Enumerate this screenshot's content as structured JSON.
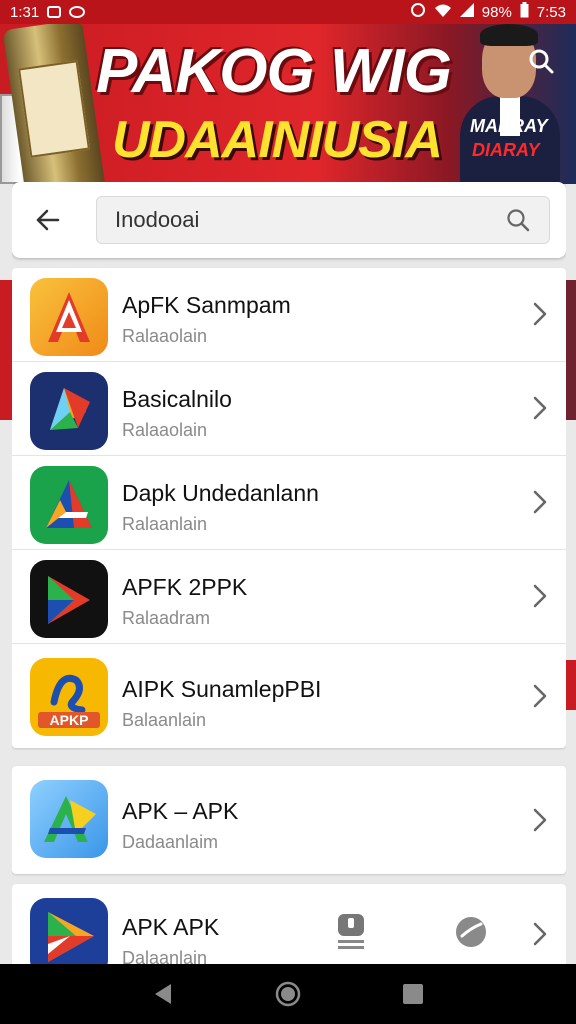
{
  "status_bar": {
    "time_left": "1:31",
    "battery": "98%",
    "time_right": "7:53"
  },
  "banner": {
    "headline_line1": "PAKOG WIG",
    "headline_line2": "UDAAINIUSIA",
    "tag_line1": "MANRAY",
    "tag_line2": "DIARAY"
  },
  "search": {
    "value": "Inodooai"
  },
  "apps": [
    {
      "name": "ApFK Sanmpam",
      "subtitle": "Ralaaolain",
      "icon": "apk-a-orange-icon",
      "color": "#f5a623"
    },
    {
      "name": "Basicalnilo",
      "subtitle": "Ralaaolain",
      "icon": "apk-play-navy-icon",
      "color": "#1c2f6e"
    },
    {
      "name": "Dapk Undedanlann",
      "subtitle": "Ralaanlain",
      "icon": "apk-a-green-icon",
      "color": "#1aa34a"
    },
    {
      "name": "APFK 2PPK",
      "subtitle": "Ralaadram",
      "icon": "apk-play-black-icon",
      "color": "#111111"
    },
    {
      "name": "AIPK SunamlepPBI",
      "subtitle": "Balaanlain",
      "icon": "apk-yellow-icon",
      "color": "#f6b800"
    },
    {
      "name": "APK – APK",
      "subtitle": "Dadaanlaim",
      "icon": "apk-a-sky-icon",
      "color": "#5db3f0"
    },
    {
      "name": "APK APK",
      "subtitle": "Dalaanlain",
      "icon": "apk-play-blue-icon",
      "color": "#1d3f9a"
    }
  ],
  "colors": {
    "status_bar": "#b8141a",
    "banner_red": "#e0262b",
    "headline_yellow": "#ffe22e"
  }
}
